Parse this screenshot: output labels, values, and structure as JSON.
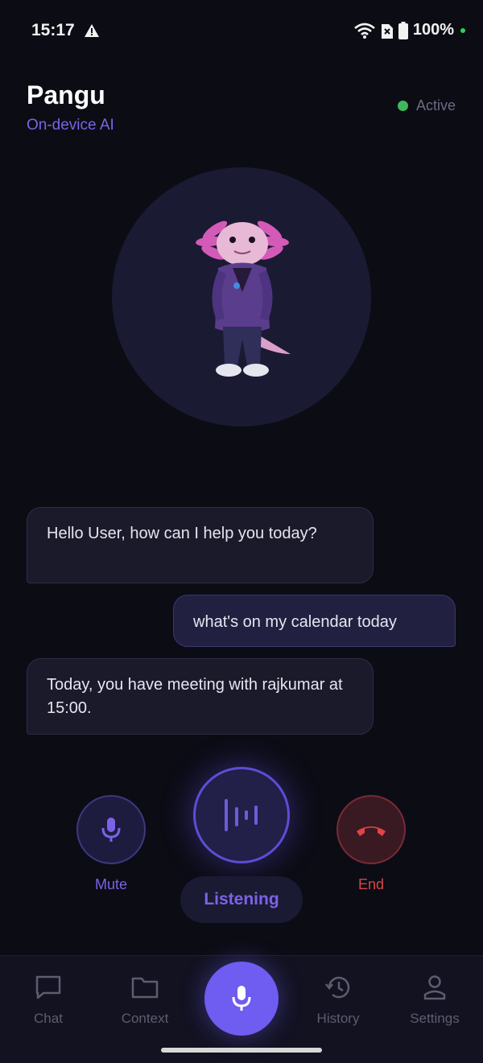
{
  "status_bar": {
    "time": "15:17",
    "battery": "100%",
    "icons": [
      "warning-icon",
      "wifi-icon",
      "no-sim-icon",
      "battery-icon"
    ]
  },
  "header": {
    "title": "Pangu",
    "subtitle": "On-device AI",
    "status": "Active",
    "status_color": "#3eb85c"
  },
  "messages": [
    {
      "sender": "assistant",
      "text": "Hello User, how can I help you today?"
    },
    {
      "sender": "user",
      "text": "what's on my calendar today"
    },
    {
      "sender": "assistant",
      "text": "Today, you have meeting with rajkumar at 15:00."
    }
  ],
  "controls": {
    "mute_label": "Mute",
    "listening_label": "Listening",
    "end_label": "End"
  },
  "nav": {
    "items": [
      {
        "label": "Chat",
        "icon": "chat-icon"
      },
      {
        "label": "Context",
        "icon": "folder-icon"
      },
      {
        "label": "",
        "icon": "mic-icon"
      },
      {
        "label": "History",
        "icon": "history-icon"
      },
      {
        "label": "Settings",
        "icon": "person-icon"
      }
    ]
  },
  "colors": {
    "accent": "#6f5cf0",
    "end": "#d84545",
    "background": "#0c0c15"
  }
}
